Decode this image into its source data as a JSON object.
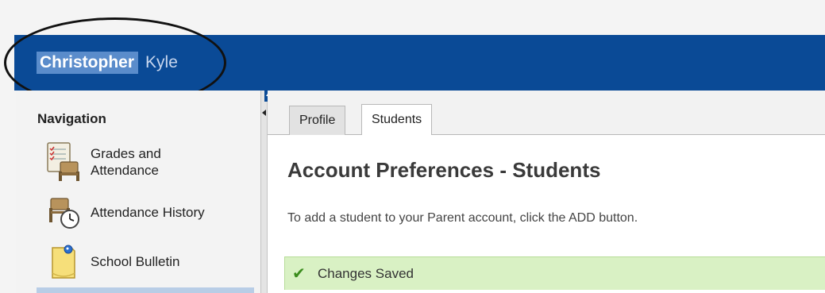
{
  "header": {
    "students": [
      {
        "name": "Christopher",
        "selected": true
      },
      {
        "name": "Kyle",
        "selected": false
      }
    ],
    "bar_color": "#0a4a96"
  },
  "navigation": {
    "title": "Navigation",
    "items": [
      {
        "label": "Grades and\nAttendance",
        "icon": "grades-attendance-icon"
      },
      {
        "label": "Attendance History",
        "icon": "attendance-history-icon"
      },
      {
        "label": "School Bulletin",
        "icon": "school-bulletin-icon"
      }
    ]
  },
  "tabs": [
    {
      "label": "Profile",
      "active": false
    },
    {
      "label": "Students",
      "active": true
    }
  ],
  "main": {
    "heading": "Account Preferences - Students",
    "instructions": "To add a student to your Parent account, click the ADD button.",
    "status_message": "Changes Saved",
    "status_color": "#d9f1c4"
  }
}
